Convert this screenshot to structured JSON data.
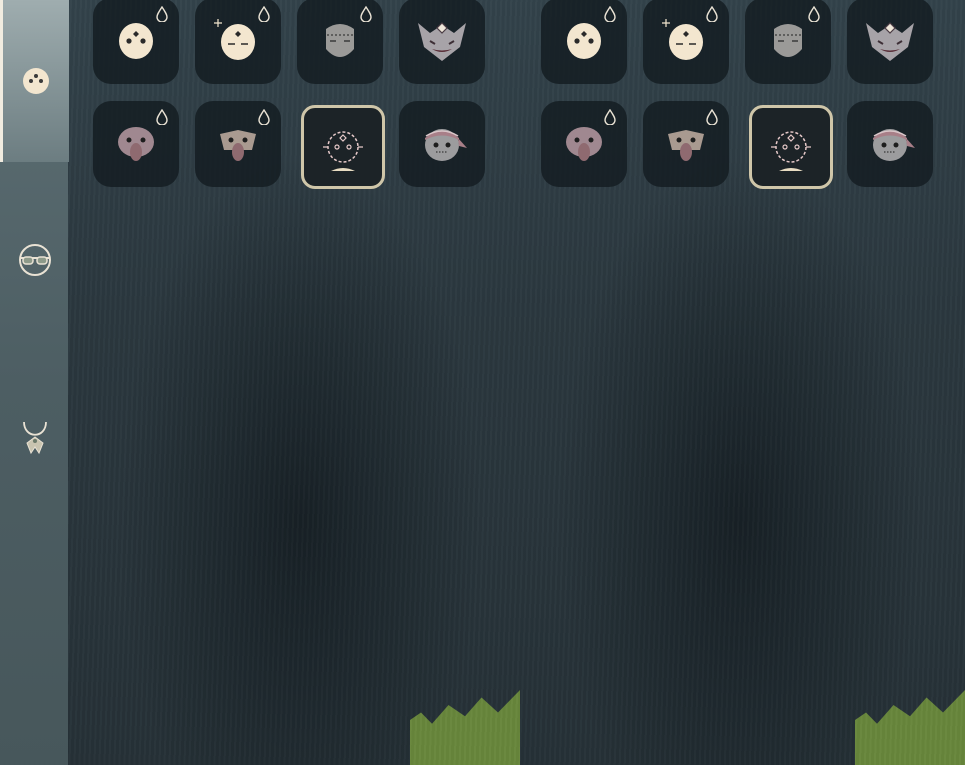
{
  "sidebar": {
    "tabs": [
      {
        "name": "masks",
        "icon": "mask-face-icon",
        "active": true
      },
      {
        "name": "glasses",
        "icon": "glasses-icon",
        "active": false
      },
      {
        "name": "necklace",
        "icon": "necklace-icon",
        "active": false
      }
    ]
  },
  "panels": [
    {
      "items": [
        {
          "icon": "mask-dotted-white-icon",
          "has_drop": true
        },
        {
          "icon": "mask-sleepy-white-icon",
          "has_drop": true
        },
        {
          "icon": "mask-stitched-gray-icon",
          "has_drop": true
        },
        {
          "icon": "mask-horned-demon-icon",
          "has_drop": false
        },
        {
          "icon": "mask-bird-pink-icon",
          "has_drop": true
        },
        {
          "icon": "mask-bird-tan-icon",
          "has_drop": true
        },
        {
          "icon": "mask-empty-slot-icon",
          "has_drop": false,
          "selected": true
        },
        {
          "icon": "mask-bandana-icon",
          "has_drop": false
        }
      ]
    },
    {
      "items": [
        {
          "icon": "mask-dotted-white-icon",
          "has_drop": true
        },
        {
          "icon": "mask-sleepy-white-icon",
          "has_drop": true
        },
        {
          "icon": "mask-stitched-gray-icon",
          "has_drop": true
        },
        {
          "icon": "mask-horned-demon-icon",
          "has_drop": false
        },
        {
          "icon": "mask-bird-pink-icon",
          "has_drop": true
        },
        {
          "icon": "mask-bird-tan-icon",
          "has_drop": true
        },
        {
          "icon": "mask-empty-slot-icon",
          "has_drop": false,
          "selected": true
        },
        {
          "icon": "mask-bandana-icon",
          "has_drop": false
        }
      ]
    }
  ],
  "colors": {
    "mask_cream": "#f3e6cf",
    "mask_gray": "#9b9a98",
    "mask_pink": "#a08890",
    "mask_tan": "#a99a90",
    "beak": "#8f6a70",
    "selected_border": "#cfc6a9",
    "grass": "#74963d"
  }
}
